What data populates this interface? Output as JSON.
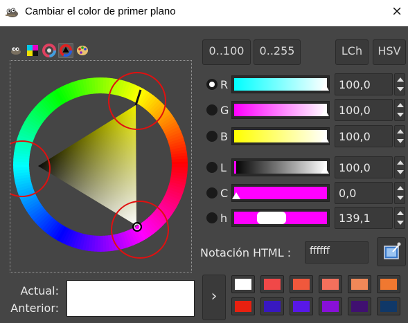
{
  "window": {
    "title": "Cambiar el color de primer plano",
    "close_label": "×"
  },
  "tabs": [
    {
      "icon": "gimp-wilber-icon",
      "active": false
    },
    {
      "icon": "cmyk-icon",
      "active": false
    },
    {
      "icon": "color-wheel-icon",
      "active": false
    },
    {
      "icon": "triangle-wheel-icon",
      "active": true
    },
    {
      "icon": "palette-icon",
      "active": false
    }
  ],
  "range_buttons": [
    "0..100",
    "0..255"
  ],
  "model_buttons": [
    "LCh",
    "HSV"
  ],
  "channels": [
    {
      "label": "R",
      "value": "100,0",
      "selected": true,
      "fraction": 1.0
    },
    {
      "label": "G",
      "value": "100,0",
      "selected": false,
      "fraction": 1.0
    },
    {
      "label": "B",
      "value": "100,0",
      "selected": false,
      "fraction": 1.0
    },
    {
      "label": "L",
      "value": "100,0",
      "selected": false,
      "fraction": 1.0
    },
    {
      "label": "C",
      "value": "0,0",
      "selected": false,
      "fraction": 0.0
    },
    {
      "label": "h",
      "value": "139,1",
      "selected": false,
      "fraction": 0.386
    }
  ],
  "html_notation": {
    "label": "Notación HTML :",
    "value": "ffffff"
  },
  "current": {
    "actual_label": "Actual:",
    "anterior_label": "Anterior:",
    "color": "#ffffff"
  },
  "arrow_label": "›",
  "history_colors": [
    "#ffffff",
    "#f04848",
    "#f0583c",
    "#f4705c",
    "#f08858",
    "#f07830",
    "#e82010",
    "#3818c0",
    "#5818e8",
    "#8810d8",
    "#401070",
    "#103868"
  ]
}
